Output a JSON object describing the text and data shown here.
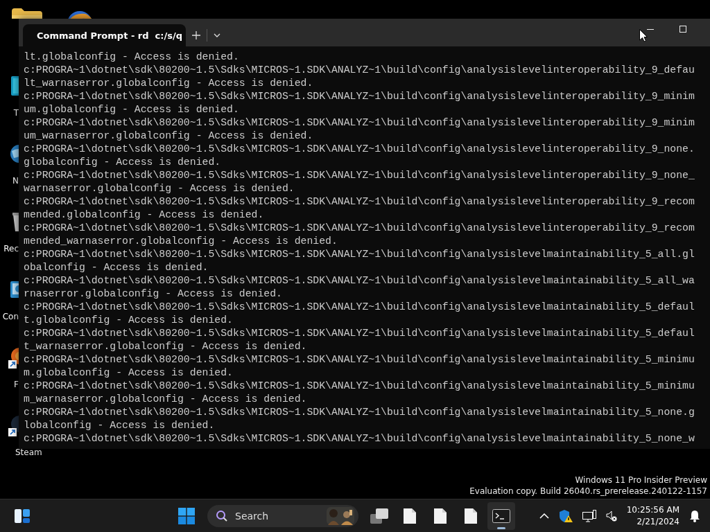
{
  "desktop": {
    "icons": [
      {
        "label": "T",
        "shortcut": false
      },
      {
        "label": "N",
        "shortcut": false
      },
      {
        "label": "Rec",
        "shortcut": false
      },
      {
        "label": "Con",
        "shortcut": false
      },
      {
        "label": "F",
        "shortcut": true
      },
      {
        "label": "Steam",
        "shortcut": true
      }
    ]
  },
  "window": {
    "tabs": [
      {
        "title": "Command Prompt - rd  c:/s/q",
        "selected": true
      }
    ],
    "lines": [
      "lt.globalconfig - Access is denied.",
      "c:PROGRA~1\\dotnet\\sdk\\80200~1.5\\Sdks\\MICROS~1.SDK\\ANALYZ~1\\build\\config\\analysislevelinteroperability_9_defau",
      "lt_warnaserror.globalconfig - Access is denied.",
      "c:PROGRA~1\\dotnet\\sdk\\80200~1.5\\Sdks\\MICROS~1.SDK\\ANALYZ~1\\build\\config\\analysislevelinteroperability_9_minim",
      "um.globalconfig - Access is denied.",
      "c:PROGRA~1\\dotnet\\sdk\\80200~1.5\\Sdks\\MICROS~1.SDK\\ANALYZ~1\\build\\config\\analysislevelinteroperability_9_minim",
      "um_warnaserror.globalconfig - Access is denied.",
      "c:PROGRA~1\\dotnet\\sdk\\80200~1.5\\Sdks\\MICROS~1.SDK\\ANALYZ~1\\build\\config\\analysislevelinteroperability_9_none.",
      "globalconfig - Access is denied.",
      "c:PROGRA~1\\dotnet\\sdk\\80200~1.5\\Sdks\\MICROS~1.SDK\\ANALYZ~1\\build\\config\\analysislevelinteroperability_9_none_",
      "warnaserror.globalconfig - Access is denied.",
      "c:PROGRA~1\\dotnet\\sdk\\80200~1.5\\Sdks\\MICROS~1.SDK\\ANALYZ~1\\build\\config\\analysislevelinteroperability_9_recom",
      "mended.globalconfig - Access is denied.",
      "c:PROGRA~1\\dotnet\\sdk\\80200~1.5\\Sdks\\MICROS~1.SDK\\ANALYZ~1\\build\\config\\analysislevelinteroperability_9_recom",
      "mended_warnaserror.globalconfig - Access is denied.",
      "c:PROGRA~1\\dotnet\\sdk\\80200~1.5\\Sdks\\MICROS~1.SDK\\ANALYZ~1\\build\\config\\analysislevelmaintainability_5_all.gl",
      "obalconfig - Access is denied.",
      "c:PROGRA~1\\dotnet\\sdk\\80200~1.5\\Sdks\\MICROS~1.SDK\\ANALYZ~1\\build\\config\\analysislevelmaintainability_5_all_wa",
      "rnaserror.globalconfig - Access is denied.",
      "c:PROGRA~1\\dotnet\\sdk\\80200~1.5\\Sdks\\MICROS~1.SDK\\ANALYZ~1\\build\\config\\analysislevelmaintainability_5_defaul",
      "t.globalconfig - Access is denied.",
      "c:PROGRA~1\\dotnet\\sdk\\80200~1.5\\Sdks\\MICROS~1.SDK\\ANALYZ~1\\build\\config\\analysislevelmaintainability_5_defaul",
      "t_warnaserror.globalconfig - Access is denied.",
      "c:PROGRA~1\\dotnet\\sdk\\80200~1.5\\Sdks\\MICROS~1.SDK\\ANALYZ~1\\build\\config\\analysislevelmaintainability_5_minimu",
      "m.globalconfig - Access is denied.",
      "c:PROGRA~1\\dotnet\\sdk\\80200~1.5\\Sdks\\MICROS~1.SDK\\ANALYZ~1\\build\\config\\analysislevelmaintainability_5_minimu",
      "m_warnaserror.globalconfig - Access is denied.",
      "c:PROGRA~1\\dotnet\\sdk\\80200~1.5\\Sdks\\MICROS~1.SDK\\ANALYZ~1\\build\\config\\analysislevelmaintainability_5_none.g",
      "lobalconfig - Access is denied.",
      "c:PROGRA~1\\dotnet\\sdk\\80200~1.5\\Sdks\\MICROS~1.SDK\\ANALYZ~1\\build\\config\\analysislevelmaintainability_5_none_w"
    ]
  },
  "watermark": [
    "Windows 11 Pro Insider Preview",
    "Evaluation copy. Build 26040.rs_prerelease.240122-1157"
  ],
  "taskbar": {
    "items": [
      {
        "kind": "widgets",
        "selected": false
      },
      {
        "kind": "start",
        "selected": false
      },
      {
        "kind": "search",
        "placeholder": "Search",
        "selected": false
      },
      {
        "kind": "taskview",
        "selected": false
      },
      {
        "kind": "file",
        "selected": false
      },
      {
        "kind": "file",
        "selected": false
      },
      {
        "kind": "file",
        "selected": false
      },
      {
        "kind": "terminal",
        "selected": true
      }
    ],
    "clock": {
      "time": "10:25:56 AM",
      "date": "2/21/2024"
    }
  }
}
